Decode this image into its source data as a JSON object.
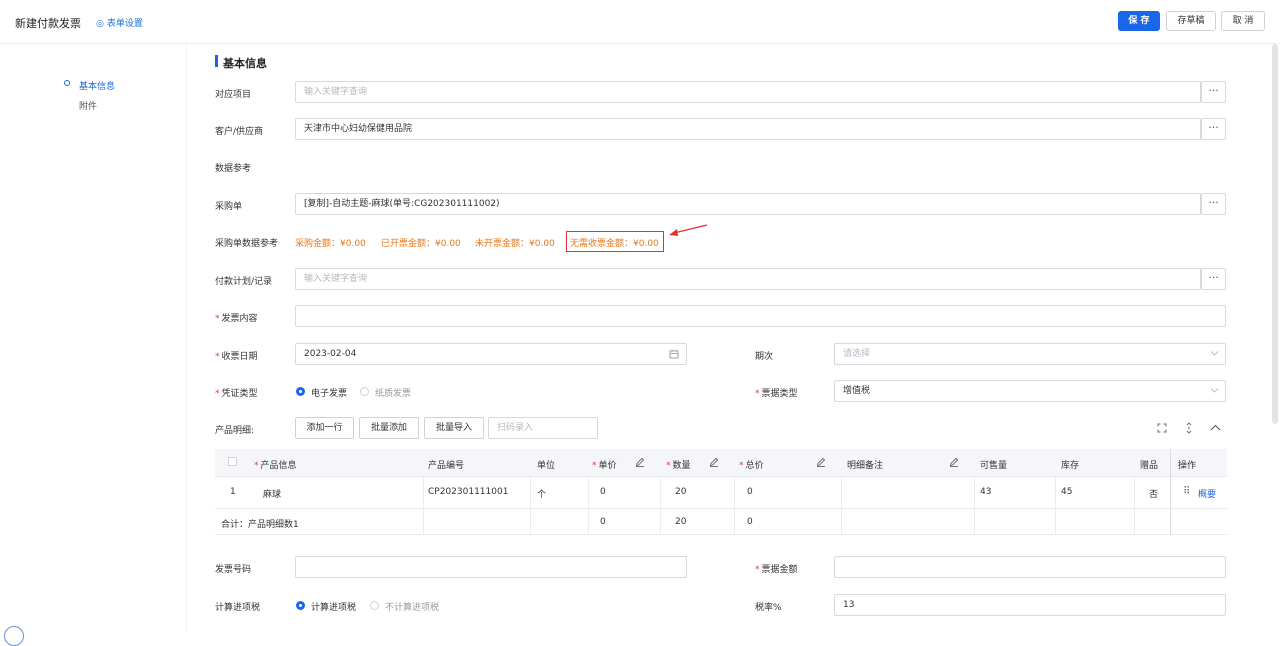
{
  "header": {
    "title": "新建付款发票",
    "form_settings": "表单设置",
    "save": "保 存",
    "draft": "存草稿",
    "cancel": "取 消"
  },
  "nav": {
    "items": [
      {
        "label": "基本信息",
        "active": true
      },
      {
        "label": "附件",
        "active": false
      }
    ]
  },
  "section": {
    "title": "基本信息"
  },
  "fields": {
    "project": {
      "label": "对应项目",
      "placeholder": "输入关键字查询"
    },
    "customer": {
      "label": "客户/供应商",
      "value": "天津市中心妇幼保健用品院"
    },
    "data_ref": {
      "label": "数据参考"
    },
    "purchase": {
      "label": "采购单",
      "value": "[复制]-自动主题-麻球(单号:CG202301111002)"
    },
    "purchase_ref": {
      "label": "采购单数据参考",
      "items": [
        "采购金额：¥0.00",
        "已开票金额：¥0.00",
        "未开票金额：¥0.00",
        "无需收票金额：¥0.00"
      ]
    },
    "payment_plan": {
      "label": "付款计划/记录",
      "placeholder": "输入关键字查询"
    },
    "invoice_content": {
      "label": "发票内容",
      "value": ""
    },
    "receive_date": {
      "label": "收票日期",
      "value": "2023-02-04"
    },
    "period": {
      "label": "期次",
      "placeholder": "请选择"
    },
    "voucher_type": {
      "label": "凭证类型",
      "options": [
        "电子发票",
        "纸质发票"
      ],
      "selected": "电子发票"
    },
    "bill_type": {
      "label": "票据类型",
      "value": "增值税"
    },
    "invoice_no": {
      "label": "发票号码",
      "value": ""
    },
    "bill_amount": {
      "label": "票据金额",
      "value": ""
    },
    "calc_tax": {
      "label": "计算进项税",
      "options": [
        "计算进项税",
        "不计算进项税"
      ],
      "selected": "计算进项税"
    },
    "tax_rate": {
      "label": "税率%",
      "value": "13"
    }
  },
  "products": {
    "label": "产品明细:",
    "buttons": [
      "添加一行",
      "批量添加",
      "批量导入"
    ],
    "scan_placeholder": "扫码录入",
    "columns": [
      "产品信息",
      "产品编号",
      "单位",
      "单价",
      "数量",
      "总价",
      "明细备注",
      "可售量",
      "库存",
      "赠品",
      "操作"
    ],
    "rows": [
      {
        "index": "1",
        "name": "麻球",
        "code": "CP202301111001",
        "unit": "个",
        "price": "0",
        "qty": "20",
        "total": "0",
        "note": "",
        "sellable": "43",
        "stock": "45",
        "gift": "否",
        "action": "概要"
      }
    ],
    "summary": {
      "label": "合计：产品明细数1",
      "price": "0",
      "qty": "20",
      "total": "0"
    }
  }
}
